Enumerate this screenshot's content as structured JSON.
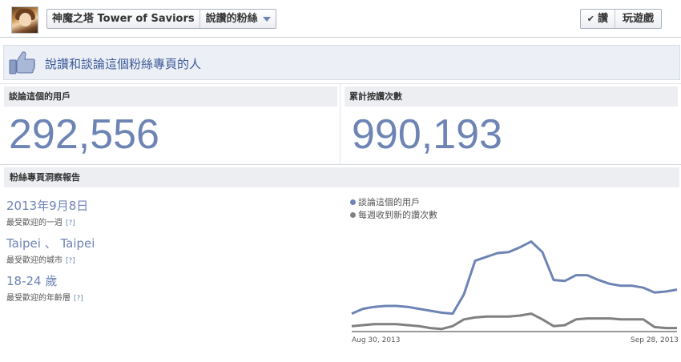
{
  "header": {
    "page_name": "神魔之塔 Tower of Saviors",
    "page_type": "說讚的粉絲",
    "like_label": "讚",
    "play_label": "玩遊戲",
    "check_glyph": "✔"
  },
  "banner": {
    "title": "說讚和談論這個粉絲專頁的人",
    "icon": "thumbs-up-icon"
  },
  "stats": {
    "talking_label": "談論這個的用戶",
    "talking_value": "292,556",
    "likes_label": "累計按讚次數",
    "likes_value": "990,193"
  },
  "insights": {
    "section_label": "粉絲專頁洞察報告",
    "help": "[?]",
    "items": [
      {
        "value": "2013年9月8日",
        "label": "最受歡迎的一週"
      },
      {
        "value": "Taipei 、 Taipei",
        "label": "最受歡迎的城市"
      },
      {
        "value": "18-24 歲",
        "label": "最受歡迎的年齡層"
      }
    ]
  },
  "chart_data": {
    "type": "line",
    "legend": "top-left",
    "grid": false,
    "x_labels": [
      "Aug 30, 2013",
      "Sep 28, 2013"
    ],
    "ylim": [
      0,
      100
    ],
    "series": [
      {
        "name": "談論這個的用戶",
        "color": "#6d84b4",
        "values": [
          17,
          22,
          24,
          25,
          25,
          24,
          22,
          20,
          18,
          17,
          37,
          72,
          76,
          80,
          81,
          86,
          92,
          81,
          52,
          51,
          57,
          57,
          52,
          48,
          46,
          46,
          44,
          39,
          40,
          42
        ]
      },
      {
        "name": "每週收到新的讚次數",
        "color": "#808080",
        "values": [
          4,
          5,
          6,
          6,
          6,
          5,
          4,
          2,
          1,
          4,
          11,
          13,
          14,
          14,
          14,
          15,
          17,
          11,
          4,
          5,
          11,
          12,
          12,
          12,
          11,
          11,
          11,
          3,
          2,
          2
        ]
      }
    ],
    "colors": {
      "accent": "#6d84b4",
      "secondary": "#808080",
      "axis": "#333333"
    }
  }
}
